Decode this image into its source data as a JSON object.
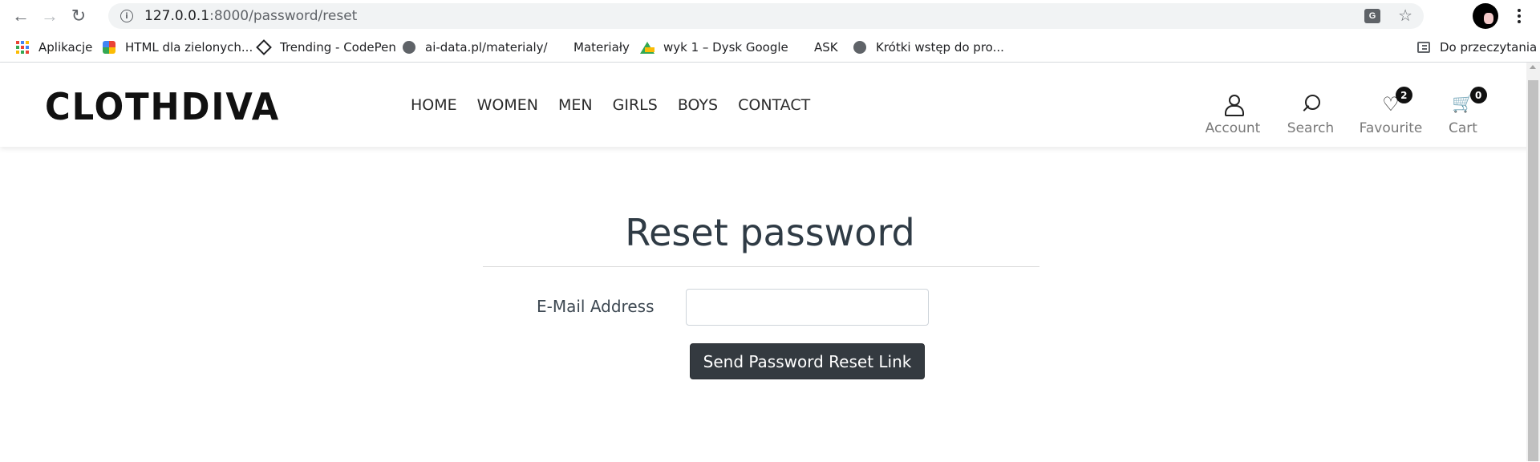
{
  "browser": {
    "url_host": "127.0.0.1",
    "url_path": ":8000/password/reset",
    "bookmarks": [
      {
        "label": "Aplikacje",
        "icon": "apps-grid-icon"
      },
      {
        "label": "HTML dla zielonych...",
        "icon": "html-favicon-icon"
      },
      {
        "label": "Trending - CodePen",
        "icon": "codepen-icon"
      },
      {
        "label": "ai-data.pl/materialy/",
        "icon": "globe-icon"
      },
      {
        "label": "Materiały",
        "icon": ""
      },
      {
        "label": "wyk 1 – Dysk Google",
        "icon": "google-drive-icon"
      },
      {
        "label": "ASK",
        "icon": ""
      },
      {
        "label": "Krótki wstęp do pro...",
        "icon": "globe-icon"
      }
    ],
    "reading_list": "Do przeczytania"
  },
  "site": {
    "logo": "CLOTHDIVA",
    "nav": [
      "HOME",
      "WOMEN",
      "MEN",
      "GIRLS",
      "BOYS",
      "CONTACT"
    ],
    "tools": {
      "account": "Account",
      "search": "Search",
      "favourite": "Favourite",
      "favourite_count": "2",
      "cart": "Cart",
      "cart_count": "0"
    }
  },
  "form": {
    "title": "Reset password",
    "email_label": "E-Mail Address",
    "email_value": "",
    "submit_label": "Send Password Reset Link"
  }
}
